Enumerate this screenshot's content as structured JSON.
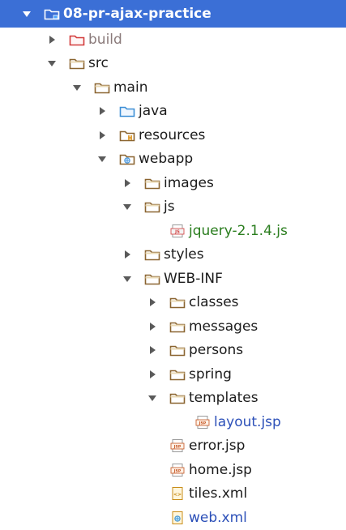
{
  "tree": [
    {
      "label": "08-pr-ajax-practice",
      "depth": 0,
      "toggle": "expanded",
      "icon": "project-folder-icon",
      "selected": true,
      "style": "normal"
    },
    {
      "label": "build",
      "depth": 1,
      "toggle": "collapsed",
      "icon": "excluded-folder-icon",
      "style": "muted"
    },
    {
      "label": "src",
      "depth": 1,
      "toggle": "expanded",
      "icon": "folder-icon",
      "style": "normal"
    },
    {
      "label": "main",
      "depth": 2,
      "toggle": "expanded",
      "icon": "folder-icon",
      "style": "normal"
    },
    {
      "label": "java",
      "depth": 3,
      "toggle": "collapsed",
      "icon": "source-folder-icon",
      "style": "normal"
    },
    {
      "label": "resources",
      "depth": 3,
      "toggle": "collapsed",
      "icon": "resources-folder-icon",
      "style": "normal"
    },
    {
      "label": "webapp",
      "depth": 3,
      "toggle": "expanded",
      "icon": "web-folder-icon",
      "style": "normal"
    },
    {
      "label": "images",
      "depth": 4,
      "toggle": "collapsed",
      "icon": "folder-icon",
      "style": "normal"
    },
    {
      "label": "js",
      "depth": 4,
      "toggle": "expanded",
      "icon": "folder-icon",
      "style": "normal"
    },
    {
      "label": "jquery-2.1.4.js",
      "depth": 5,
      "toggle": "none",
      "icon": "js-file-icon",
      "style": "green"
    },
    {
      "label": "styles",
      "depth": 4,
      "toggle": "collapsed",
      "icon": "folder-icon",
      "style": "normal"
    },
    {
      "label": "WEB-INF",
      "depth": 4,
      "toggle": "expanded",
      "icon": "folder-icon",
      "style": "normal"
    },
    {
      "label": "classes",
      "depth": 5,
      "toggle": "collapsed",
      "icon": "folder-icon",
      "style": "normal"
    },
    {
      "label": "messages",
      "depth": 5,
      "toggle": "collapsed",
      "icon": "folder-icon",
      "style": "normal"
    },
    {
      "label": "persons",
      "depth": 5,
      "toggle": "collapsed",
      "icon": "folder-icon",
      "style": "normal"
    },
    {
      "label": "spring",
      "depth": 5,
      "toggle": "collapsed",
      "icon": "folder-icon",
      "style": "normal"
    },
    {
      "label": "templates",
      "depth": 5,
      "toggle": "expanded",
      "icon": "folder-icon",
      "style": "normal"
    },
    {
      "label": "layout.jsp",
      "depth": 6,
      "toggle": "none",
      "icon": "jsp-file-icon",
      "style": "blue"
    },
    {
      "label": "error.jsp",
      "depth": 5,
      "toggle": "none",
      "icon": "jsp-file-icon",
      "style": "normal"
    },
    {
      "label": "home.jsp",
      "depth": 5,
      "toggle": "none",
      "icon": "jsp-file-icon",
      "style": "normal"
    },
    {
      "label": "tiles.xml",
      "depth": 5,
      "toggle": "none",
      "icon": "xml-file-icon",
      "style": "normal"
    },
    {
      "label": "web.xml",
      "depth": 5,
      "toggle": "none",
      "icon": "web-xml-file-icon",
      "style": "blue"
    }
  ]
}
